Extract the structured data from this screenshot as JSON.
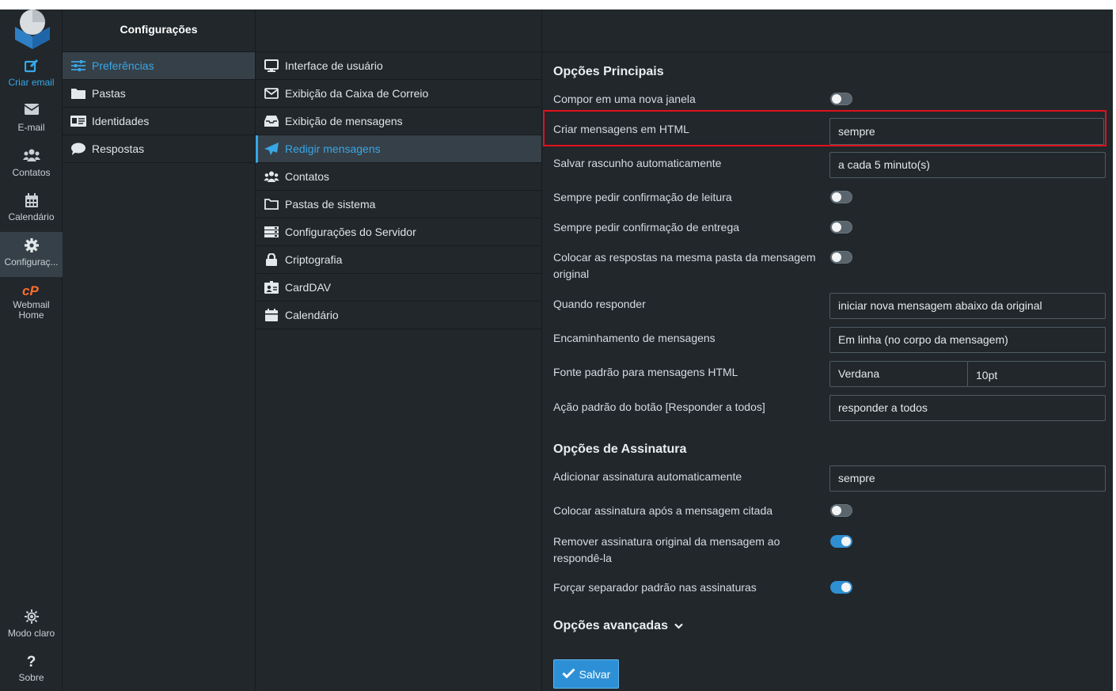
{
  "rail": {
    "compose": "Criar email",
    "mail": "E-mail",
    "contacts": "Contatos",
    "calendar": "Calendário",
    "settings": "Configuraç...",
    "webmail_home": "Webmail Home",
    "light_mode": "Modo claro",
    "about": "Sobre"
  },
  "col2": {
    "title": "Configurações",
    "items": [
      "Preferências",
      "Pastas",
      "Identidades",
      "Respostas"
    ]
  },
  "col3": {
    "items": [
      "Interface de usuário",
      "Exibição da Caixa de Correio",
      "Exibição de mensagens",
      "Redigir mensagens",
      "Contatos",
      "Pastas de sistema",
      "Configurações do Servidor",
      "Criptografia",
      "CardDAV",
      "Calendário"
    ]
  },
  "main": {
    "section1": "Opções Principais",
    "compose_new_window": "Compor em uma nova janela",
    "compose_html": "Criar mensagens em HTML",
    "compose_html_value": "sempre",
    "draft_autosave": "Salvar rascunho automaticamente",
    "draft_autosave_value": "a cada 5 minuto(s)",
    "mdn_default": "Sempre pedir confirmação de leitura",
    "dsn_default": "Sempre pedir confirmação de entrega",
    "reply_same_folder": "Colocar as respostas na mesma pasta da mensagem original",
    "reply_mode": "Quando responder",
    "reply_mode_value": "iniciar nova mensagem abaixo da original",
    "forward_attachment": "Encaminhamento de mensagens",
    "forward_attachment_value": "Em linha (no corpo da mensagem)",
    "default_font": "Fonte padrão para mensagens HTML",
    "default_font_value": "Verdana",
    "default_font_size_value": "10pt",
    "reply_all_mode": "Ação padrão do botão [Responder a todos]",
    "reply_all_mode_value": "responder a todos",
    "section2": "Opções de Assinatura",
    "show_sig": "Adicionar assinatura automaticamente",
    "show_sig_value": "sempre",
    "sig_below": "Colocar assinatura após a mensagem citada",
    "strip_existing_sig": "Remover assinatura original da mensagem ao respondê-la",
    "force_sig_separator": "Forçar separador padrão nas assinaturas",
    "advanced": "Opções avançadas",
    "save": "Salvar"
  },
  "colors": {
    "background": "#21272b",
    "accent": "#37a7e8",
    "highlight_box": "#e0111b",
    "button": "#2d90d6"
  },
  "toggles": {
    "compose_new_window": false,
    "mdn_default": false,
    "dsn_default": false,
    "reply_same_folder": false,
    "sig_below": false,
    "strip_existing_sig": true,
    "force_sig_separator": true
  }
}
